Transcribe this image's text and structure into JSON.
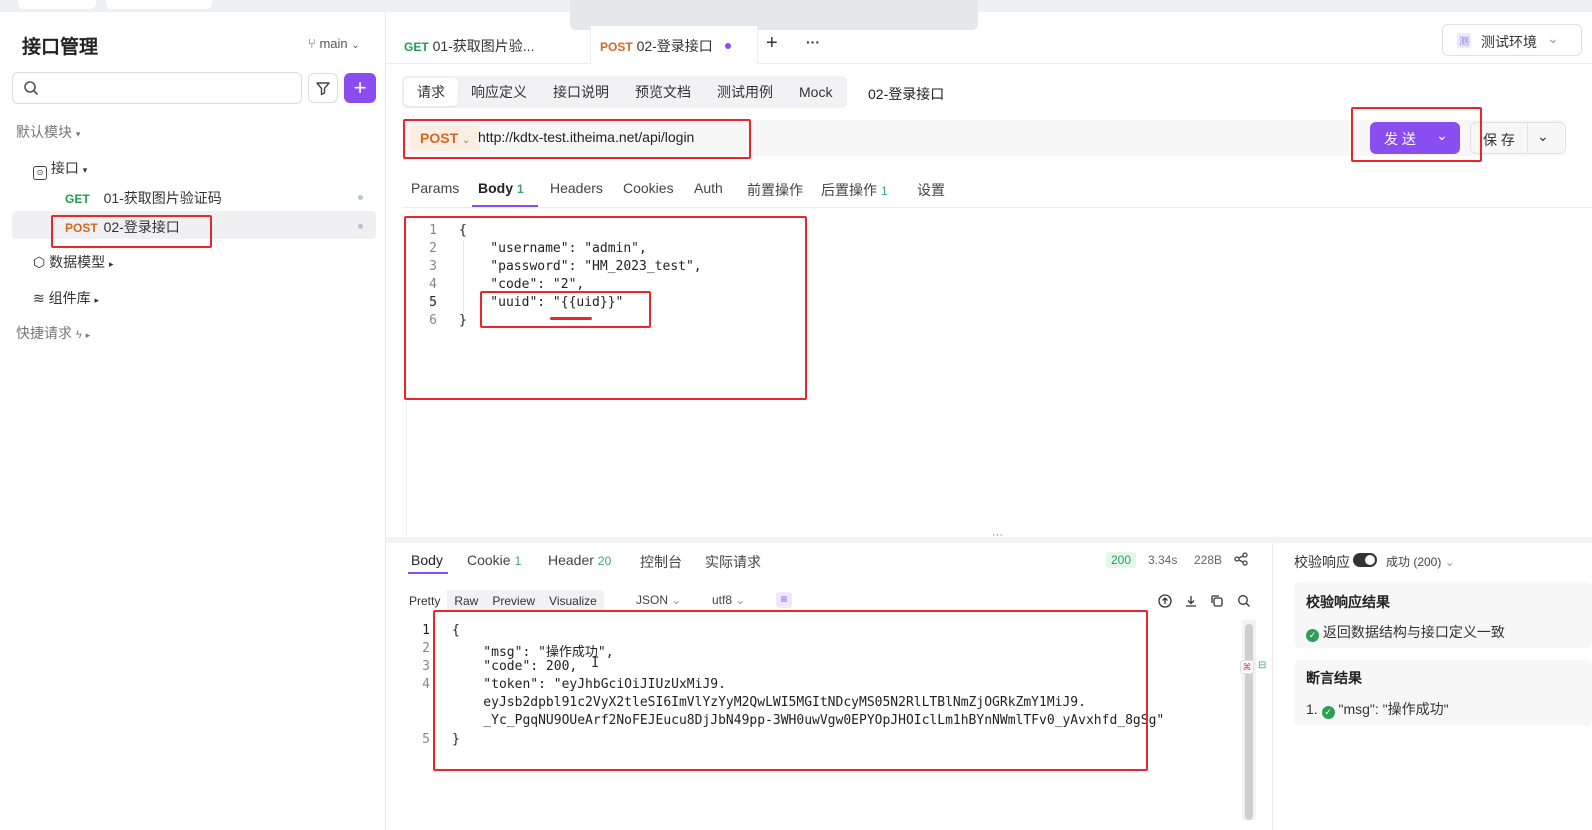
{
  "sidebar": {
    "title": "接口管理",
    "branch": "main",
    "search_placeholder": "",
    "add_label": "+",
    "default_module": "默认模块",
    "api_group": "接口",
    "items": [
      {
        "method": "GET",
        "name": "01-获取图片验证码"
      },
      {
        "method": "POST",
        "name": "02-登录接口"
      }
    ],
    "data_model": "数据模型",
    "components": "组件库",
    "quick_request": "快捷请求"
  },
  "doc_tabs": [
    {
      "method": "GET",
      "name": "01-获取图片验..."
    },
    {
      "method": "POST",
      "name": "02-登录接口"
    }
  ],
  "doc_tab_add": "+",
  "doc_tab_more": "···",
  "environment": {
    "badge": "测",
    "label": "测试环境"
  },
  "sub_tabs": [
    "请求",
    "响应定义",
    "接口说明",
    "预览文档",
    "测试用例",
    "Mock"
  ],
  "request_name": "02-登录接口",
  "url_bar": {
    "method": "POST",
    "url": "http://kdtx-test.itheima.net/api/login"
  },
  "send_label": "发 送",
  "save_label": "保 存",
  "request_tabs": [
    {
      "label": "Params",
      "count": ""
    },
    {
      "label": "Body",
      "count": "1"
    },
    {
      "label": "Headers",
      "count": ""
    },
    {
      "label": "Cookies",
      "count": ""
    },
    {
      "label": "Auth",
      "count": ""
    },
    {
      "label": "前置操作",
      "count": ""
    },
    {
      "label": "后置操作",
      "count": "1"
    },
    {
      "label": "设置",
      "count": ""
    }
  ],
  "request_body": {
    "line_numbers": [
      "1",
      "2",
      "3",
      "4",
      "5",
      "6"
    ],
    "lines": [
      "{",
      "    \"username\": \"admin\",",
      "    \"password\": \"HM_2023_test\",",
      "    \"code\": \"2\",",
      "    \"uuid\": \"{{uid}}\"",
      "}"
    ]
  },
  "resize_handle": "···",
  "response_tabs": [
    {
      "label": "Body",
      "count": ""
    },
    {
      "label": "Cookie",
      "count": "1"
    },
    {
      "label": "Header",
      "count": "20"
    },
    {
      "label": "控制台",
      "count": ""
    },
    {
      "label": "实际请求",
      "count": ""
    }
  ],
  "response_status": {
    "code": "200",
    "time": "3.34s",
    "size": "228B"
  },
  "format_modes": [
    "Pretty",
    "Raw",
    "Preview",
    "Visualize"
  ],
  "format_type": "JSON",
  "encoding": "utf8",
  "response_body": {
    "line_numbers": [
      "1",
      "2",
      "3",
      "4",
      "",
      "",
      "5"
    ],
    "lines": [
      "{",
      "    \"msg\": \"操作成功\",",
      "    \"code\": 200,",
      "    \"token\": \"eyJhbGciOiJIUzUxMiJ9.",
      "    eyJsb2dpbl91c2VyX2tleSI6ImVlYzYyM2QwLWI5MGItNDcyMS05N2RlLTBlNmZjOGRkZmY1MiJ9.",
      "    _Yc_PgqNU9OUeArf2NoFEJEucu8DjJbN49pp-3WH0uwVgw0EPYOpJHOIclLm1hBYnNWmlTFv0_yAvxhfd_8gSg\"",
      "}"
    ]
  },
  "validation": {
    "label": "校验响应",
    "status": "成功 (200)",
    "result_title": "校验响应结果",
    "result_text": "返回数据结构与接口定义一致",
    "assert_title": "断言结果",
    "assert_index": "1.",
    "assert_text": "\"msg\": \"操作成功\""
  },
  "colors": {
    "accent": "#8a4ef0",
    "post": "#d2691e",
    "get": "#1f9d55",
    "annotation": "#e8262b"
  }
}
